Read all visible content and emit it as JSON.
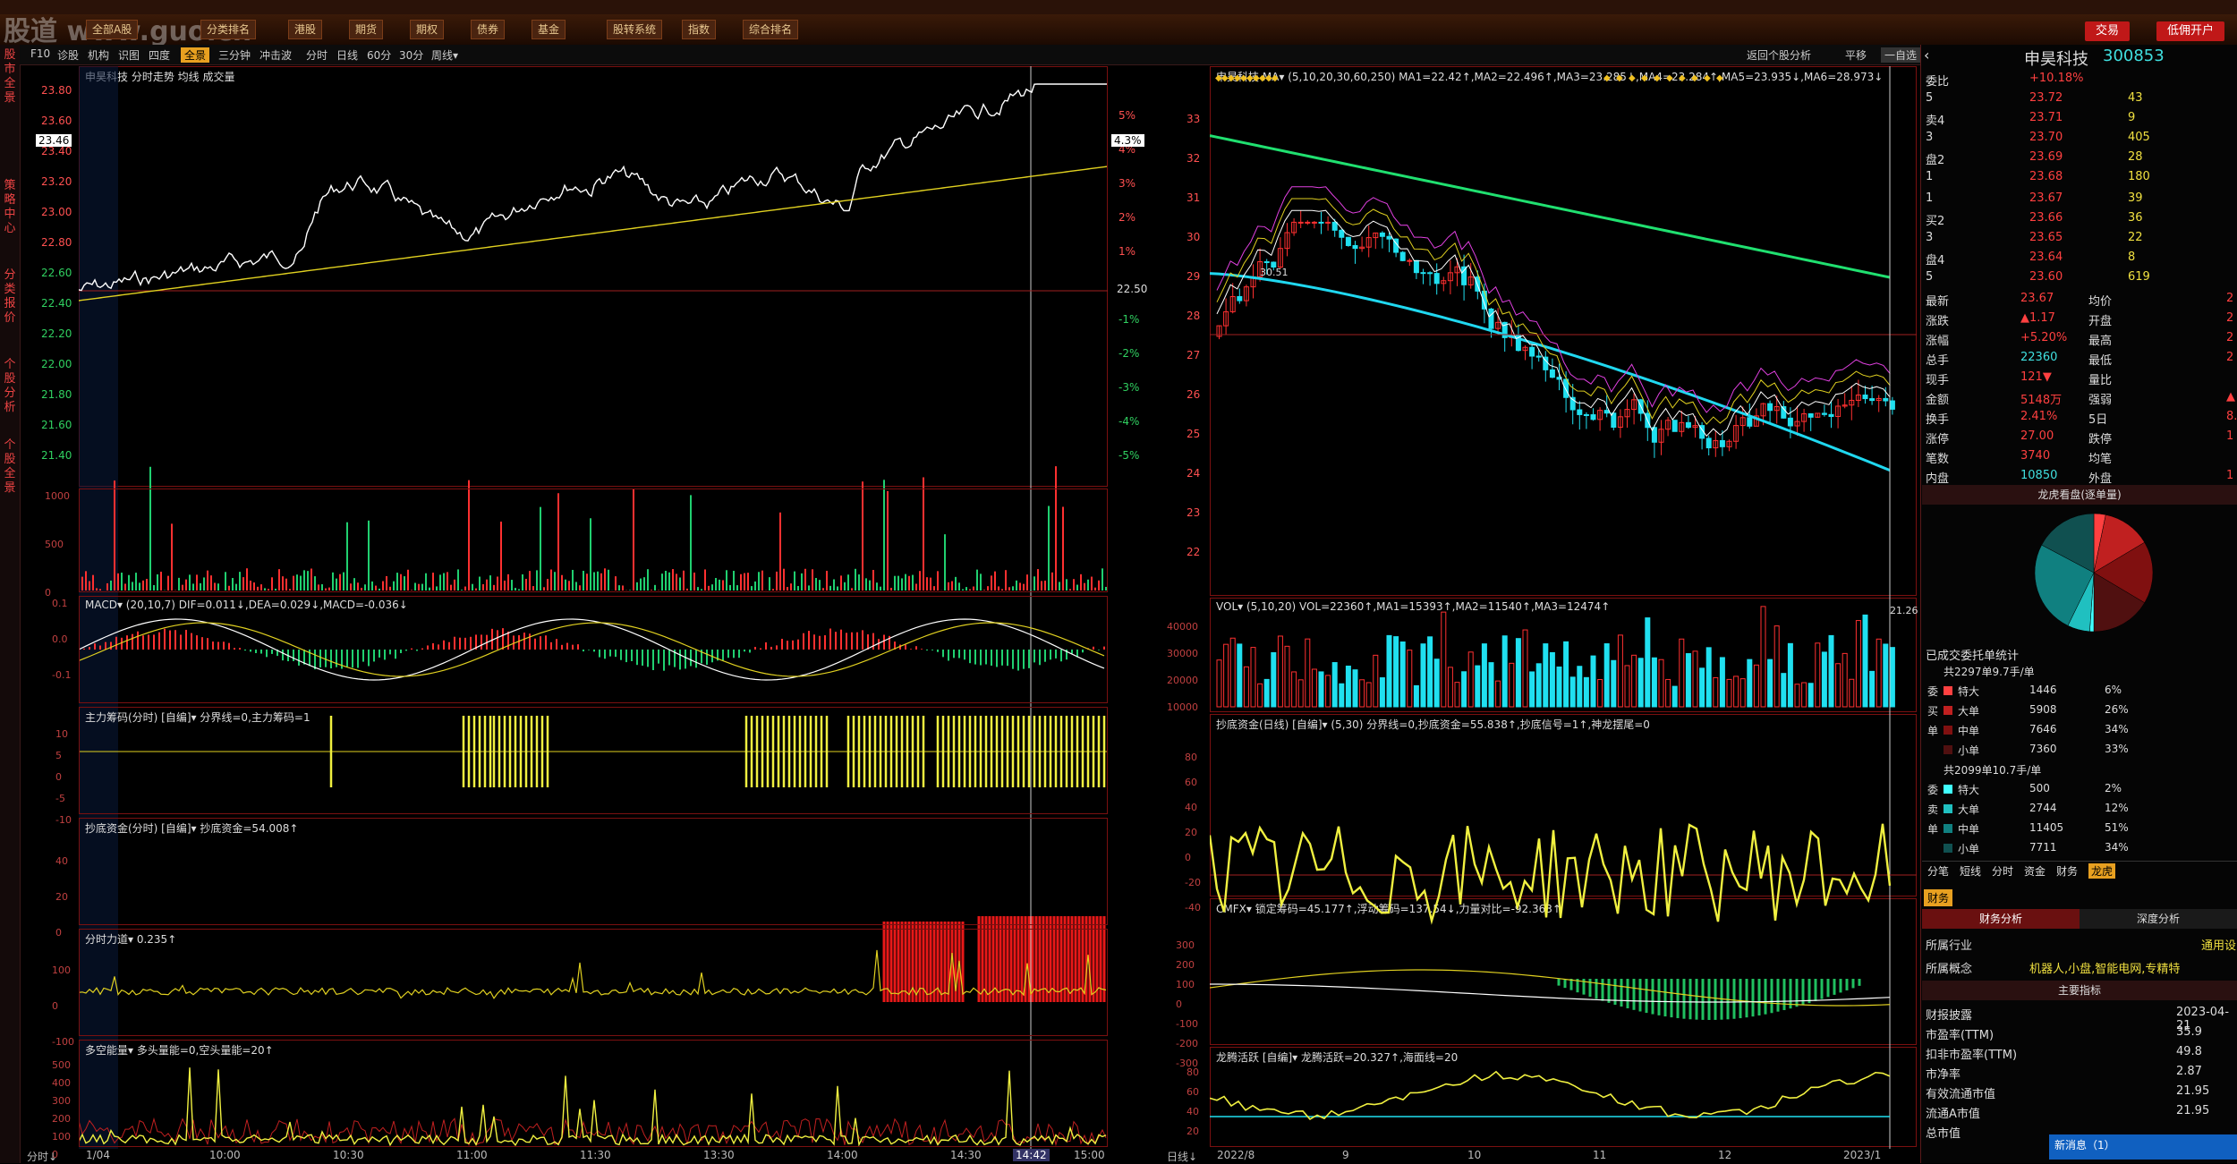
{
  "toolbar": {
    "buttons": [
      "全部A股",
      "分类排名",
      "港股",
      "期货",
      "期权",
      "债券",
      "基金",
      "股转系统",
      "指数",
      "综合排名"
    ],
    "right_buttons": [
      "交易",
      "低佣开户"
    ],
    "watermark": "股道 www.guo.cn"
  },
  "left_tabs": [
    "股市全景",
    "策略中心",
    "分类报价",
    "个股分析",
    "个股全景"
  ],
  "subbar": {
    "left_items": [
      "F10",
      "诊股",
      "机构",
      "识图",
      "四度",
      "全景",
      "三分钟",
      "冲击波"
    ],
    "active": "全景",
    "period_items": [
      "分时",
      "日线",
      "60分",
      "30分",
      "周线▾"
    ],
    "right_items": [
      "返回个股分析",
      "平移",
      "一自选"
    ]
  },
  "intraday": {
    "title": "申昊科技  分时走势  均线 成交量",
    "price_ticks": [
      "23.80",
      "23.60",
      "23.40",
      "23.20",
      "23.00",
      "22.80",
      "22.60",
      "22.40",
      "22.20",
      "22.00",
      "21.80",
      "21.60",
      "21.40"
    ],
    "pct_ticks": [
      "5%",
      "4%",
      "3%",
      "2%",
      "1%",
      "",
      "-1%",
      "-2%",
      "-3%",
      "-4%",
      "-5%"
    ],
    "current_price": "23.46",
    "current_pct": "4.3%",
    "ref_price": "22.50",
    "vol_ticks": [
      "1000",
      "500",
      "0"
    ],
    "time_ticks": [
      "1/04",
      "10:00",
      "10:30",
      "11:00",
      "11:30",
      "13:30",
      "14:00",
      "14:30",
      "15:00"
    ],
    "cursor_time": "14:42",
    "bottom_left": "分时↓",
    "macd_title": "MACD▾  (20,10,7)  DIF=0.011↓,DEA=0.029↓,MACD=-0.036↓",
    "macd_ticks": [
      "0.1",
      "0.0",
      "-0.1"
    ],
    "main_title": "主力筹码(分时) [自编]▾  分界线=0,主力筹码=1",
    "main_ticks": [
      "10",
      "5",
      "0",
      "-5",
      "-10"
    ],
    "bottom_title": "抄底资金(分时) [自编]▾  抄底资金=54.008↑",
    "bottom_ticks": [
      "40",
      "20",
      "0"
    ],
    "force_title": "分时力道▾  0.235↑",
    "force_ticks": [
      "100",
      "0",
      "-100"
    ],
    "energy_title": "多空能量▾  多头量能=0,空头量能=20↑",
    "energy_ticks": [
      "500",
      "400",
      "300",
      "200",
      "100",
      "0"
    ]
  },
  "kline": {
    "title": "申昊科技 MA▾ (5,10,20,30,60,250)  MA1=22.42↑,MA2=22.496↑,MA3=23.285↓,MA4=23.284↑,MA5=23.935↓,MA6=28.973↓",
    "price_ticks": [
      "33",
      "32",
      "31",
      "30",
      "29",
      "28",
      "27",
      "26",
      "25",
      "24",
      "23",
      "22"
    ],
    "high_label": "30.51",
    "low_label": "21.26",
    "vol_title": "VOL▾  (5,10,20)  VOL=22360↑,MA1=15393↑,MA2=11540↑,MA3=12474↑",
    "vol_ticks": [
      "40000",
      "30000",
      "20000",
      "10000"
    ],
    "fund_title": "抄底资金(日线) [自编]▾  (5,30)  分界线=0,抄底资金=55.838↑,抄底信号=1↑,神龙摆尾=0",
    "fund_ticks": [
      "80",
      "60",
      "40",
      "20",
      "0",
      "-20",
      "-40"
    ],
    "cmfx_title": "CMFX▾  锁定筹码=45.177↑,浮动筹码=137.54↓,力量对比=-92.363↑",
    "cmfx_ticks": [
      "300",
      "200",
      "100",
      "0",
      "-100",
      "-200",
      "-300"
    ],
    "dragon_title": "龙腾活跃 [自编]▾  龙腾活跃=20.327↑,海面线=20",
    "dragon_ticks": [
      "80",
      "60",
      "40",
      "20"
    ],
    "date_ticks": [
      "2022/8",
      "9",
      "10",
      "11",
      "12",
      "2023/1"
    ],
    "bottom_left": "日线↓"
  },
  "quote": {
    "name": "申昊科技",
    "code": "300853",
    "webi_label": "委比",
    "webi_value": "+10.18%",
    "asks": [
      {
        "label": "5",
        "price": "23.72",
        "vol": "43"
      },
      {
        "label": "4",
        "price": "23.71",
        "vol": "9"
      },
      {
        "label": "3",
        "price": "23.70",
        "vol": "405"
      },
      {
        "label": "2",
        "price": "23.69",
        "vol": "28"
      },
      {
        "label": "1",
        "price": "23.68",
        "vol": "180"
      }
    ],
    "bids": [
      {
        "label": "1",
        "price": "23.67",
        "vol": "39"
      },
      {
        "label": "2",
        "price": "23.66",
        "vol": "36"
      },
      {
        "label": "3",
        "price": "23.65",
        "vol": "22"
      },
      {
        "label": "4",
        "price": "23.64",
        "vol": "8"
      },
      {
        "label": "5",
        "price": "23.60",
        "vol": "619"
      }
    ],
    "stats": [
      {
        "k1": "最新",
        "v1": "23.67",
        "k2": "均价",
        "v2": "2"
      },
      {
        "k1": "涨跌",
        "v1": "▲1.17",
        "k2": "开盘",
        "v2": "2"
      },
      {
        "k1": "涨幅",
        "v1": "+5.20%",
        "k2": "最高",
        "v2": "2"
      },
      {
        "k1": "总手",
        "v1": "22360",
        "k2": "最低",
        "v2": "2"
      },
      {
        "k1": "现手",
        "v1": "121▼",
        "k2": "量比",
        "v2": ""
      },
      {
        "k1": "金额",
        "v1": "5148万",
        "k2": "强弱",
        "v2": "▲"
      },
      {
        "k1": "换手",
        "v1": "2.41%",
        "k2": "5日",
        "v2": "8."
      },
      {
        "k1": "涨停",
        "v1": "27.00",
        "k2": "跌停",
        "v2": "1"
      },
      {
        "k1": "笔数",
        "v1": "3740",
        "k2": "均笔",
        "v2": ""
      },
      {
        "k1": "内盘",
        "v1": "10850",
        "k2": "外盘",
        "v2": "1"
      }
    ],
    "pie_title": "龙虎看盘(逐单量)",
    "order_title": "已成交委托单统计",
    "buy_summary": "共2297单9.7手/单",
    "buy_rows": [
      {
        "side": "委",
        "name": "特大",
        "vol": "1446",
        "pct": "6%",
        "color": "#ff4040"
      },
      {
        "side": "买",
        "name": "大单",
        "vol": "5908",
        "pct": "26%",
        "color": "#c02020"
      },
      {
        "side": "单",
        "name": "中单",
        "vol": "7646",
        "pct": "34%",
        "color": "#801010"
      },
      {
        "side": "",
        "name": "小单",
        "vol": "7360",
        "pct": "33%",
        "color": "#501010"
      }
    ],
    "sell_summary": "共2099单10.7手/单",
    "sell_rows": [
      {
        "side": "委",
        "name": "特大",
        "vol": "500",
        "pct": "2%",
        "color": "#40ffff"
      },
      {
        "side": "卖",
        "name": "大单",
        "vol": "2744",
        "pct": "12%",
        "color": "#20c0c0"
      },
      {
        "side": "单",
        "name": "中单",
        "vol": "11405",
        "pct": "51%",
        "color": "#108080"
      },
      {
        "side": "",
        "name": "小单",
        "vol": "7711",
        "pct": "34%",
        "color": "#105050"
      }
    ],
    "tabs": [
      "分笔",
      "短线",
      "分时",
      "资金",
      "财务",
      "龙虎"
    ],
    "active_tab": "龙虎",
    "fin_tab": "财务",
    "fin_subtabs": [
      "财务分析",
      "深度分析"
    ],
    "industry_label": "所属行业",
    "industry_value": "通用设",
    "concept_label": "所属概念",
    "concept_value": "机器人,小盘,智能电网,专精特",
    "main_index_title": "主要指标",
    "fin_rows": [
      {
        "k": "财报披露",
        "v": "2023-04-21"
      },
      {
        "k": "市盈率(TTM)",
        "v": "35.9"
      },
      {
        "k": "扣非市盈率(TTM)",
        "v": "49.8"
      },
      {
        "k": "市净率",
        "v": "2.87"
      },
      {
        "k": "有效流通市值",
        "v": "21.95"
      },
      {
        "k": "流通A市值",
        "v": "21.95"
      },
      {
        "k": "总市值",
        "v": ""
      }
    ],
    "new_msg": "新消息（1）"
  },
  "colors": {
    "up": "#ff3030",
    "down": "#20d070",
    "cyan": "#20e0f0",
    "yellow": "#f0f040",
    "grid": "#7a1010"
  }
}
